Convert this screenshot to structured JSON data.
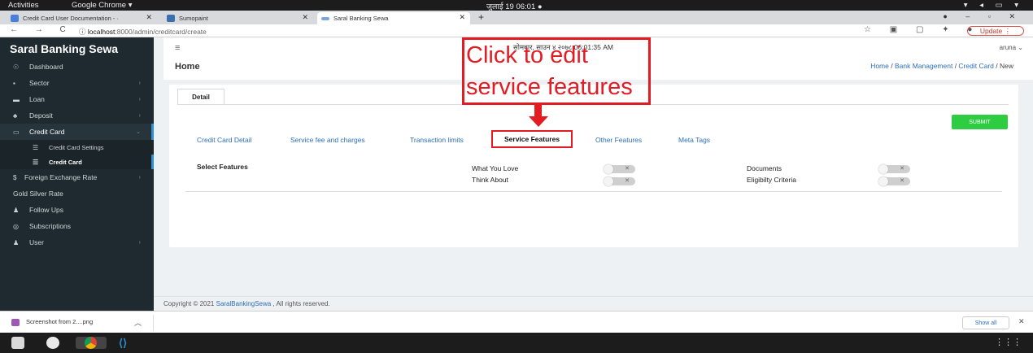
{
  "os": {
    "activities": "Activities",
    "app_name": "Google Chrome ▾",
    "clock": "जुलाई 19  06:01",
    "clock_dot": "●",
    "tray": "▾ ◂ ▭ ▾"
  },
  "browser": {
    "tabs": [
      {
        "label": "Credit Card User Documentation - ·",
        "close": "✕",
        "color": "#4a7fd9"
      },
      {
        "label": "Sumopaint",
        "close": "✕",
        "color": "#3a6fb0"
      },
      {
        "label": "Saral Banking Sewa",
        "close": "✕",
        "color": "#7aa7e0"
      }
    ],
    "new_tab": "+",
    "window_controls": "● – ▫ ✕",
    "nav": "← → C",
    "url_host": "localhost",
    "url_path": ":8000/admin/creditcard/create",
    "toolbar_icons": "☆ ▣ ▢ ✦ ●",
    "update_label": "Update  ⋮"
  },
  "sidebar": {
    "brand": "Saral Banking Sewa",
    "items": [
      {
        "label": "Dashboard",
        "icon": "☉",
        "chevron": ""
      },
      {
        "label": "Sector",
        "icon": "▪",
        "chevron": "›"
      },
      {
        "label": "Loan",
        "icon": "▬",
        "chevron": "›"
      },
      {
        "label": "Deposit",
        "icon": "♣",
        "chevron": "›"
      },
      {
        "label": "Credit Card",
        "icon": "▭",
        "chevron": "⌄"
      },
      {
        "label": "Credit Card Settings",
        "icon": "☰",
        "chevron": ""
      },
      {
        "label": "Credit Card",
        "icon": "☰",
        "chevron": ""
      },
      {
        "label": "Foreign Exchange Rate",
        "icon": "$",
        "chevron": "›"
      },
      {
        "label": "Gold Silver Rate",
        "icon": "",
        "chevron": ""
      },
      {
        "label": "Follow Ups",
        "icon": "♟",
        "chevron": ""
      },
      {
        "label": "Subscriptions",
        "icon": "◎",
        "chevron": ""
      },
      {
        "label": "User",
        "icon": "♟",
        "chevron": "›"
      }
    ]
  },
  "header": {
    "menu_icon": "≡",
    "datetime": "सोमबार, साउन ४ २०७८ 06:01:35 AM",
    "user": "aruna ⌄",
    "title": "Home",
    "breadcrumb": [
      "Home",
      "Bank Management",
      "Credit Card",
      "New"
    ]
  },
  "form": {
    "detail_tab": "Detail",
    "submit": "SUBMIT",
    "feature_tabs": [
      "Credit Card Detail",
      "Service fee and charges",
      "Transaction limits",
      "Service Features",
      "Other Features",
      "Meta Tags"
    ],
    "select_label": "Select Features",
    "features": [
      "What You Love",
      "Think About",
      "Documents",
      "Eligibilty Criteria"
    ],
    "toggle_states": [
      false,
      false,
      false,
      false
    ]
  },
  "annotation": {
    "line1": "Click to edit",
    "line2": "service features",
    "color": "#e31b23"
  },
  "footer": {
    "prefix": "Copyright © 2021 ",
    "link": "SaralBankingSewa",
    "suffix": " , All rights reserved."
  },
  "downloads": {
    "file": "Screenshot from 2....png",
    "caret": "︿",
    "show_all": "Show all",
    "close": "✕"
  },
  "dock": {
    "grid_icon": "⋮⋮⋮"
  }
}
